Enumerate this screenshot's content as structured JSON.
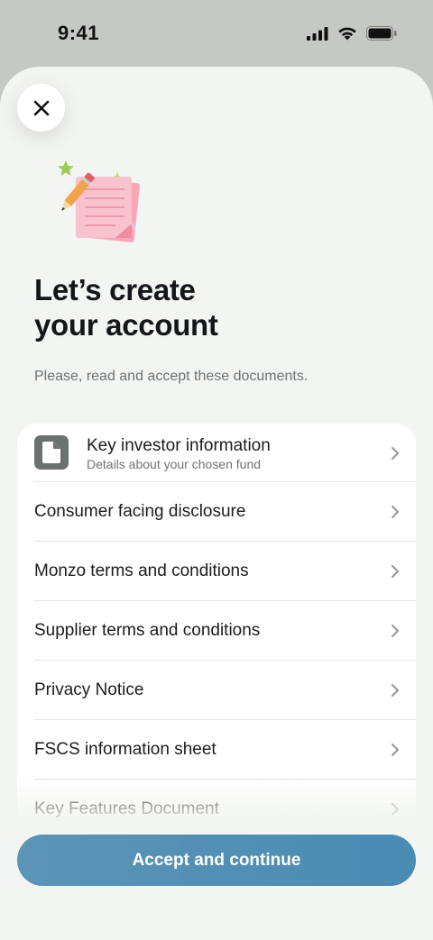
{
  "status_bar": {
    "time": "9:41"
  },
  "header": {
    "close_icon": "close-icon",
    "illustration": "notepad-pencil-illustration"
  },
  "main": {
    "title_line1": "Let’s create",
    "title_line2": "your account",
    "subtitle": "Please, read and accept these documents."
  },
  "documents": {
    "first": {
      "title": "Key investor information",
      "subtitle": "Details about your chosen fund",
      "icon": "document-icon"
    },
    "items": [
      {
        "label": "Consumer facing disclosure"
      },
      {
        "label": "Monzo terms and conditions"
      },
      {
        "label": "Supplier terms and conditions"
      },
      {
        "label": "Privacy Notice"
      },
      {
        "label": "FSCS information sheet"
      },
      {
        "label": "Key Features Document"
      }
    ]
  },
  "cta": {
    "label": "Accept and continue"
  },
  "colors": {
    "accent": "#4a8bb4",
    "sheet_bg": "#f2f5f1",
    "status_bg": "#c6c8c4"
  }
}
